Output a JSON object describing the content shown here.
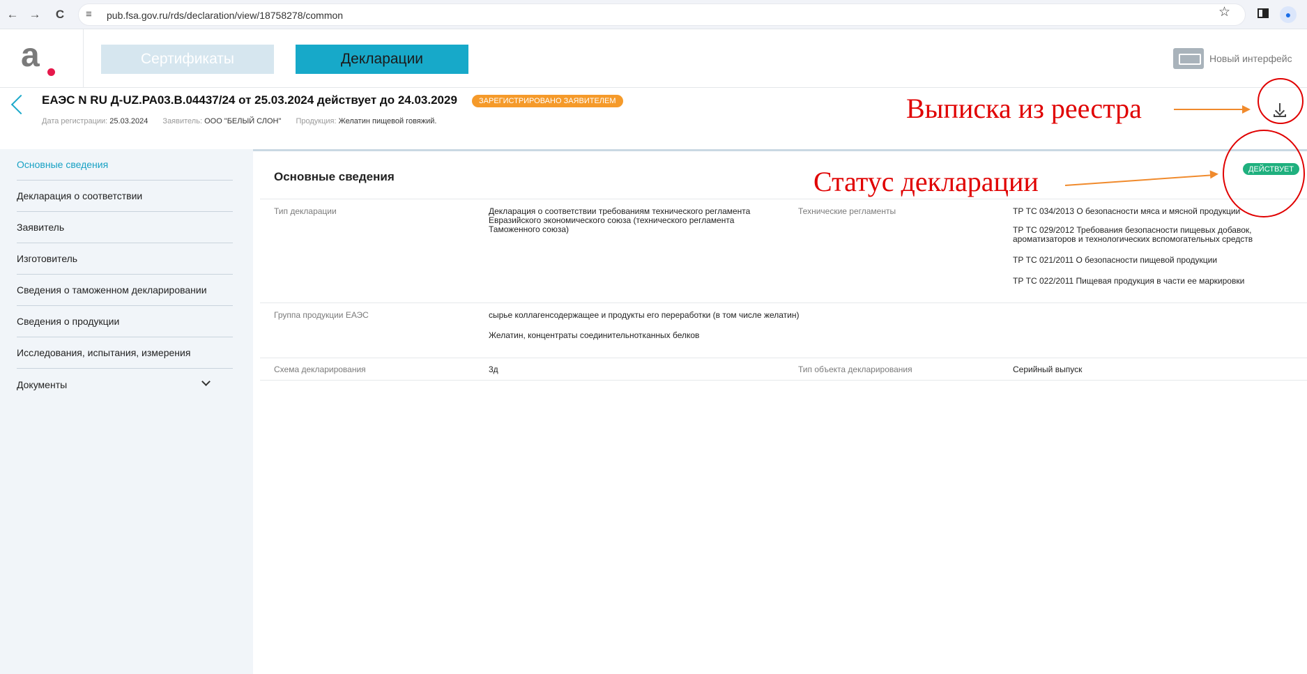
{
  "browser": {
    "back": "←",
    "forward": "→",
    "reload": "C",
    "tune": "≡",
    "url": "pub.fsa.gov.ru/rds/declaration/view/18758278/common",
    "star": "☆",
    "profile": "●"
  },
  "header": {
    "tabs": [
      "Сертификаты",
      "Декларации"
    ],
    "active_tab": "Декларации",
    "new_interface": "Новый интерфейс"
  },
  "declaration": {
    "title": "ЕАЭС N RU Д-UZ.РА03.В.04437/24 от 25.03.2024 действует до 24.03.2029",
    "status_pill": "ЗАРЕГИСТРИРОВАНО ЗАЯВИТЕЛЕМ",
    "meta": [
      {
        "label": "Дата регистрации:",
        "value": "25.03.2024"
      },
      {
        "label": "Заявитель:",
        "value": "ООО \"БЕЛЫЙ СЛОН\""
      },
      {
        "label": "Продукция:",
        "value": "Желатин пищевой говяжий."
      }
    ]
  },
  "sidebar": {
    "items": [
      "Основные сведения",
      "Декларация о соответствии",
      "Заявитель",
      "Изготовитель",
      "Сведения о таможенном декларировании",
      "Сведения о продукции",
      "Исследования, испытания, измерения",
      "Документы"
    ],
    "active_index": 0
  },
  "main": {
    "section_title": "Основные сведения",
    "status_badge": "ДЕЙСТВУЕТ",
    "rows": {
      "type_label": "Тип декларации",
      "type_value": "Декларация о соответствии требованиям технического регламента Евразийского экономического союза (технического регламента Таможенного союза)",
      "regs_label": "Технические регламенты",
      "regs": [
        "ТР ТС 034/2013 О безопасности мяса и мясной продукции",
        "ТР ТС 029/2012 Требования безопасности пищевых добавок, ароматизаторов и технологических вспомогательных средств",
        "ТР ТС 021/2011 О безопасности пищевой продукции",
        "ТР ТС 022/2011 Пищевая продукция в части ее маркировки"
      ],
      "group_label": "Группа продукции ЕАЭС",
      "group_values": [
        "сырье коллагенсодержащее и продукты его переработки (в том числе желатин)",
        "Желатин, концентраты соединительнотканных белков"
      ],
      "scheme_label": "Схема декларирования",
      "scheme_value": "3д",
      "object_label": "Тип объекта декларирования",
      "object_value": "Серийный выпуск"
    }
  },
  "annotations": {
    "extract": "Выписка из реестра",
    "status": "Статус декларации",
    "color": "#e00000",
    "arrow_color": "#f08a2c"
  },
  "colors": {
    "accent": "#17a9c9",
    "pill": "#f59a2a",
    "badge": "#1fb07e"
  }
}
